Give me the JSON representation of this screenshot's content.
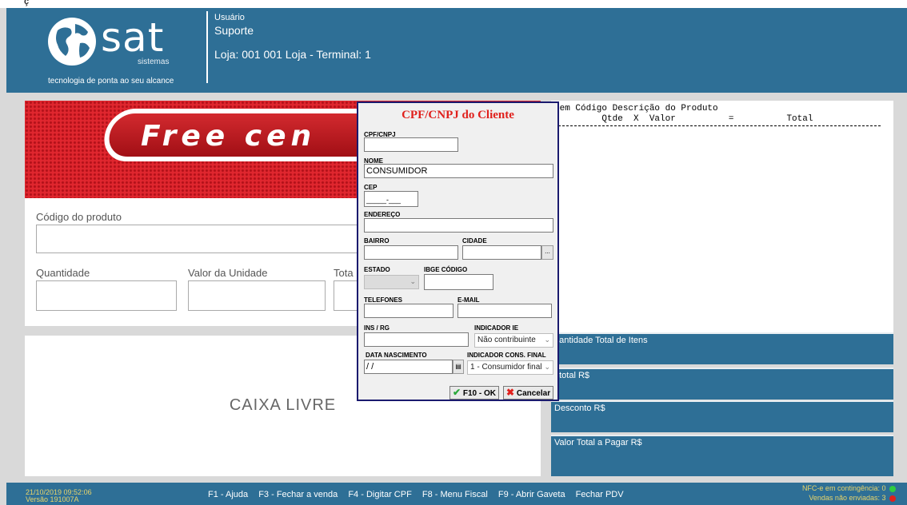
{
  "window": {
    "title_fragment": "ç"
  },
  "header": {
    "logo_text": "sat",
    "logo_sub": "sistemas",
    "tagline": "tecnologia de ponta ao seu alcance",
    "user_caption": "Usuário",
    "user_name": "Suporte",
    "store_line": "Loja: 001 001 Loja - Terminal: 1"
  },
  "banner": {
    "text": "Free cen"
  },
  "entry": {
    "codigo_label": "Código do produto",
    "quantidade_label": "Quantidade",
    "valor_unidade_label": "Valor da Unidade",
    "total_label": "Tota"
  },
  "status": {
    "caixa": "CAIXA LIVRE"
  },
  "receipt": {
    "header_line1": "tem Código Descrição do Produto",
    "header_line2": "         Qtde  X  Valor          =          Total"
  },
  "totals": [
    {
      "label": "uantidade Total de Itens"
    },
    {
      "label": "btotal R$"
    },
    {
      "label": "Desconto R$"
    },
    {
      "label": "Valor Total a Pagar R$"
    }
  ],
  "dialog": {
    "title": "CPF/CNPJ do Cliente",
    "cpf_label": "CPF/CNPJ",
    "cpf_value": "",
    "nome_label": "NOME",
    "nome_value": "CONSUMIDOR",
    "cep_label": "CEP",
    "cep_value": "_____-___",
    "endereco_label": "ENDEREÇO",
    "bairro_label": "BAIRRO",
    "cidade_label": "CIDADE",
    "estado_label": "ESTADO",
    "ibge_label": "IBGE CÓDIGO",
    "telefones_label": "TELEFONES",
    "email_label": "E-MAIL",
    "ins_label": "INS / RG",
    "indicador_ie_label": "INDICADOR IE",
    "indicador_ie_value": "Não contribuinte",
    "data_nasc_label": "DATA NASCIMENTO",
    "data_nasc_value": "/ /",
    "indicador_cons_label": "INDICADOR CONS. FINAL",
    "indicador_cons_value": "1 - Consumidor final",
    "ok_button": "F10 - OK",
    "cancel_button": "Cancelar",
    "browse_button": "..."
  },
  "footer": {
    "datetime": "21/10/2019 09:52:06",
    "version": "Versão 191007A",
    "keys": [
      "F1 - Ajuda",
      "F3 - Fechar a venda",
      "F4 - Digitar CPF",
      "F8 - Menu Fiscal",
      "F9 - Abrir Gaveta",
      "Fechar PDV"
    ],
    "nfc_contingencia": "NFC-e em contingência: 0",
    "vendas_nao_enviadas": "Vendas não enviadas: 3",
    "status_ok_color": "#2ecc40",
    "status_alert_color": "#e0201c"
  }
}
